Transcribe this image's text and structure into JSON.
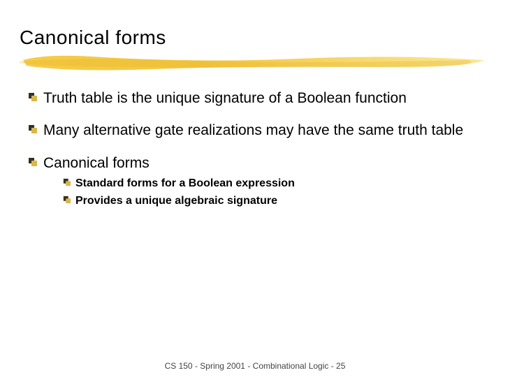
{
  "title": "Canonical forms",
  "bullets": [
    {
      "text": "Truth table is the unique signature of a Boolean function"
    },
    {
      "text": "Many alternative gate realizations may have the same truth table"
    },
    {
      "text": "Canonical forms",
      "sub": [
        {
          "text": "Standard forms for a Boolean expression"
        },
        {
          "text": "Provides a unique algebraic signature"
        }
      ]
    }
  ],
  "footer": "CS 150 - Spring  2001 - Combinational Logic - 25"
}
